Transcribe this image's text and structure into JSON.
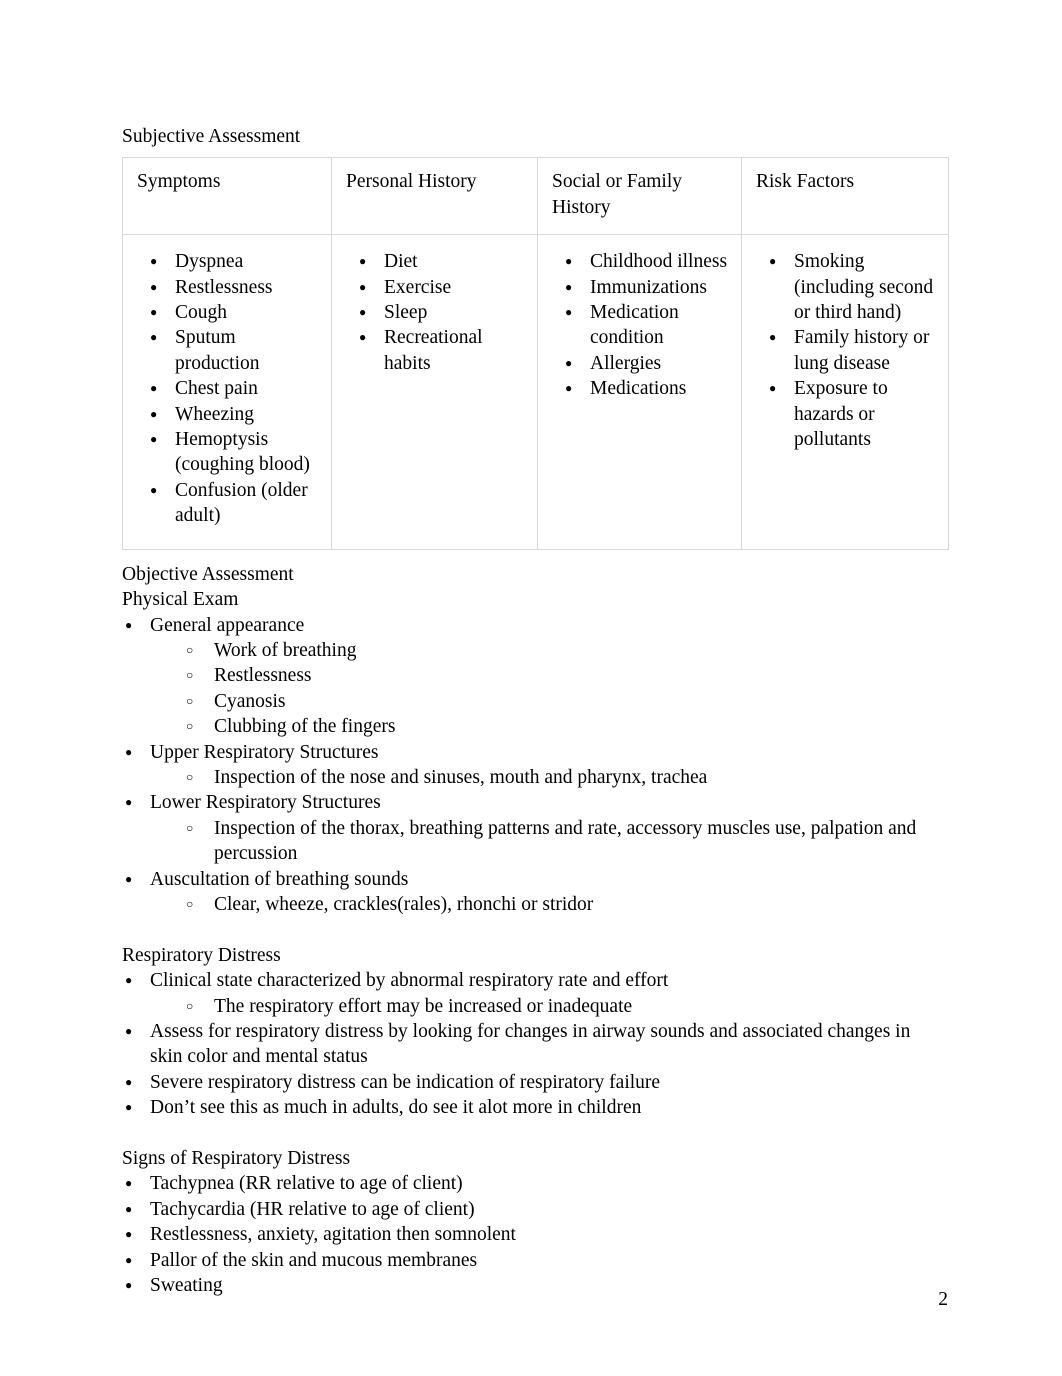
{
  "document": {
    "page_number": "2"
  },
  "sections": {
    "subjective": {
      "heading": "Subjective Assessment",
      "table": {
        "headers": [
          "Symptoms",
          "Personal History",
          "Social or Family History",
          "Risk Factors"
        ],
        "columns": [
          [
            "Dyspnea",
            "Restlessness",
            "Cough",
            "Sputum production",
            "Chest pain",
            "Wheezing",
            "Hemoptysis (coughing blood)",
            "Confusion (older adult)"
          ],
          [
            "Diet",
            "Exercise",
            "Sleep",
            "Recreational habits"
          ],
          [
            "Childhood illness",
            "Immunizations",
            "Medication condition",
            "Allergies",
            "Medications"
          ],
          [
            "Smoking (including second or third hand)",
            "Family history or lung disease",
            "Exposure to hazards or pollutants"
          ]
        ]
      }
    },
    "objective": {
      "heading": "Objective Assessment",
      "subheading": "Physical Exam",
      "items": [
        {
          "text": "General appearance",
          "sub": [
            "Work of breathing",
            "Restlessness",
            "Cyanosis",
            "Clubbing of the fingers"
          ]
        },
        {
          "text": "Upper Respiratory Structures",
          "sub": [
            "Inspection of the nose and sinuses, mouth and pharynx, trachea"
          ]
        },
        {
          "text": "Lower Respiratory Structures",
          "sub": [
            "Inspection of the thorax, breathing patterns and rate, accessory muscles use, palpation and percussion"
          ]
        },
        {
          "text": "Auscultation of breathing sounds",
          "sub": [
            "Clear, wheeze, crackles(rales), rhonchi or stridor"
          ]
        }
      ]
    },
    "respiratory_distress": {
      "heading": "Respiratory Distress",
      "items": [
        {
          "text": "Clinical state characterized by abnormal respiratory rate and effort",
          "sub": [
            "The respiratory effort may be increased or inadequate"
          ]
        },
        {
          "text": "Assess for respiratory distress by looking for changes in airway sounds and associated changes in skin color and mental status",
          "sub": []
        },
        {
          "text": "Severe respiratory distress can be indication of respiratory failure",
          "sub": []
        },
        {
          "text": "Don’t see this as much in adults, do see it alot more in children",
          "sub": []
        }
      ]
    },
    "signs": {
      "heading": "Signs of Respiratory Distress",
      "items": [
        {
          "text": "Tachypnea (RR relative to age of client)",
          "sub": []
        },
        {
          "text": "Tachycardia (HR relative to age of client)",
          "sub": []
        },
        {
          "text": "Restlessness, anxiety, agitation then somnolent",
          "sub": []
        },
        {
          "text": "Pallor of the skin and mucous membranes",
          "sub": []
        },
        {
          "text": "Sweating",
          "sub": []
        }
      ]
    }
  }
}
